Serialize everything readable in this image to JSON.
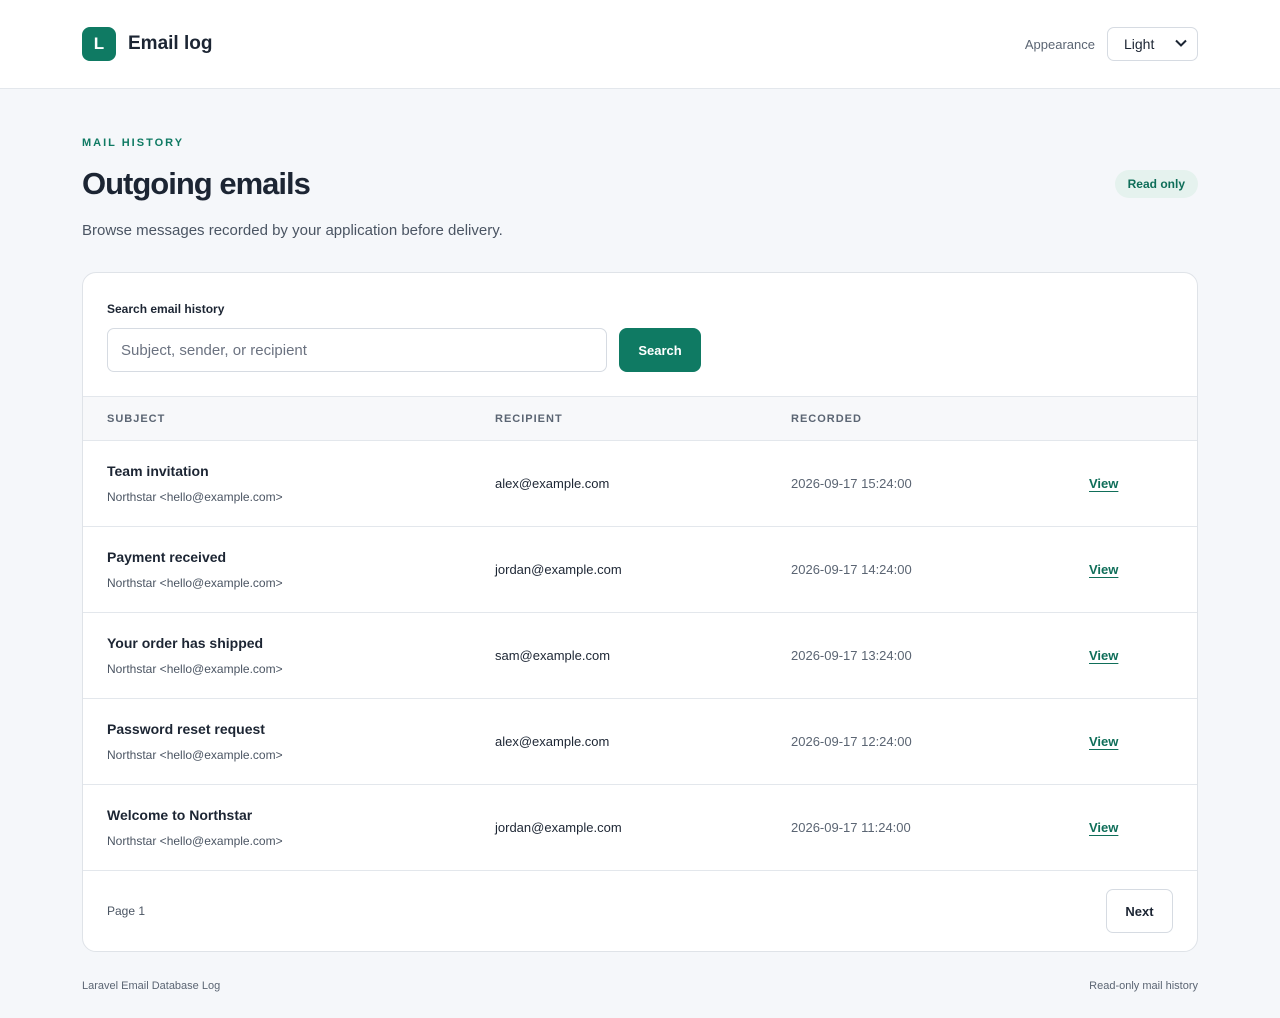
{
  "header": {
    "logo_letter": "L",
    "app_title": "Email log",
    "appearance_label": "Appearance",
    "appearance_value": "Light"
  },
  "page": {
    "eyebrow": "MAIL HISTORY",
    "title": "Outgoing emails",
    "badge": "Read only",
    "subtitle": "Browse messages recorded by your application before delivery."
  },
  "search": {
    "label": "Search email history",
    "placeholder": "Subject, sender, or recipient",
    "button": "Search"
  },
  "table": {
    "columns": [
      "SUBJECT",
      "RECIPIENT",
      "RECORDED"
    ],
    "view_label": "View",
    "rows": [
      {
        "subject": "Team invitation",
        "sender": "Northstar <hello@example.com>",
        "recipient": "alex@example.com",
        "recorded": "2026-09-17 15:24:00"
      },
      {
        "subject": "Payment received",
        "sender": "Northstar <hello@example.com>",
        "recipient": "jordan@example.com",
        "recorded": "2026-09-17 14:24:00"
      },
      {
        "subject": "Your order has shipped",
        "sender": "Northstar <hello@example.com>",
        "recipient": "sam@example.com",
        "recorded": "2026-09-17 13:24:00"
      },
      {
        "subject": "Password reset request",
        "sender": "Northstar <hello@example.com>",
        "recipient": "alex@example.com",
        "recorded": "2026-09-17 12:24:00"
      },
      {
        "subject": "Welcome to Northstar",
        "sender": "Northstar <hello@example.com>",
        "recipient": "jordan@example.com",
        "recorded": "2026-09-17 11:24:00"
      }
    ]
  },
  "pagination": {
    "page_label": "Page 1",
    "next": "Next"
  },
  "footer": {
    "left": "Laravel Email Database Log",
    "right": "Read-only mail history"
  },
  "colors": {
    "accent": "#0f7a63",
    "badge_bg": "#e5f2ee",
    "page_bg": "#f5f7fa"
  },
  "icons": {
    "select_chevron": "chevron-down-icon"
  }
}
